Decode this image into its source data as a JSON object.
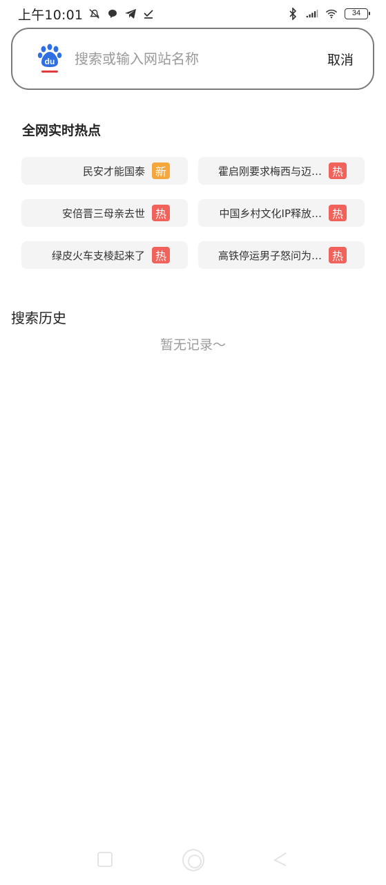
{
  "status_bar": {
    "time": "上午10:01",
    "battery": "34",
    "icons": [
      "mute-icon",
      "message-icon",
      "telegram-icon",
      "check-download-icon",
      "bluetooth-icon",
      "signal-icon",
      "wifi-icon",
      "battery-icon"
    ]
  },
  "search": {
    "placeholder": "搜索或输入网站名称",
    "cancel_label": "取消",
    "logo": "baidu-logo",
    "brand_colors": {
      "blue": "#2f6fe4",
      "red": "#e23b3b"
    }
  },
  "hot": {
    "title": "全网实时热点",
    "items": [
      {
        "label": "民安才能国泰",
        "badge": "新",
        "badge_type": "new"
      },
      {
        "label": "霍启刚要求梅西与迈…",
        "badge": "热",
        "badge_type": "hot"
      },
      {
        "label": "安倍晋三母亲去世",
        "badge": "热",
        "badge_type": "hot"
      },
      {
        "label": "中国乡村文化IP释放…",
        "badge": "热",
        "badge_type": "hot"
      },
      {
        "label": "绿皮火车支棱起来了",
        "badge": "热",
        "badge_type": "hot"
      },
      {
        "label": "高铁停运男子怒问为…",
        "badge": "热",
        "badge_type": "hot"
      }
    ],
    "badge_colors": {
      "hot": "#f0625a",
      "new": "#f5a63c"
    }
  },
  "history": {
    "title": "搜索历史",
    "empty_text": "暂无记录～"
  }
}
